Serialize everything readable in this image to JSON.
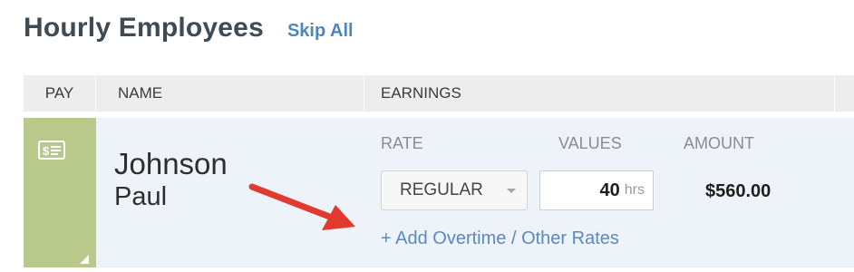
{
  "header": {
    "title": "Hourly Employees",
    "skip_all": "Skip All"
  },
  "table": {
    "columns": {
      "pay": "PAY",
      "name": "NAME",
      "earnings": "EARNINGS"
    }
  },
  "employee": {
    "last_name": "Johnson",
    "first_name": "Paul",
    "earnings": {
      "rate_header": "RATE",
      "values_header": "VALUES",
      "amount_header": "AMOUNT",
      "rate_selected": "REGULAR",
      "hours_value": "40",
      "hours_unit": "hrs",
      "amount": "$560.00",
      "add_link": "+ Add Overtime / Other Rates"
    }
  },
  "colors": {
    "pay_cell": "#b9c98c",
    "row_bg": "#edf3f8",
    "link": "#5a89c0",
    "arrow": "#e23a2e"
  },
  "icons": {
    "pay": "check-icon",
    "corner": "corner-triangle-icon",
    "select_caret": "chevron-down-icon",
    "annotation": "red-arrow"
  }
}
